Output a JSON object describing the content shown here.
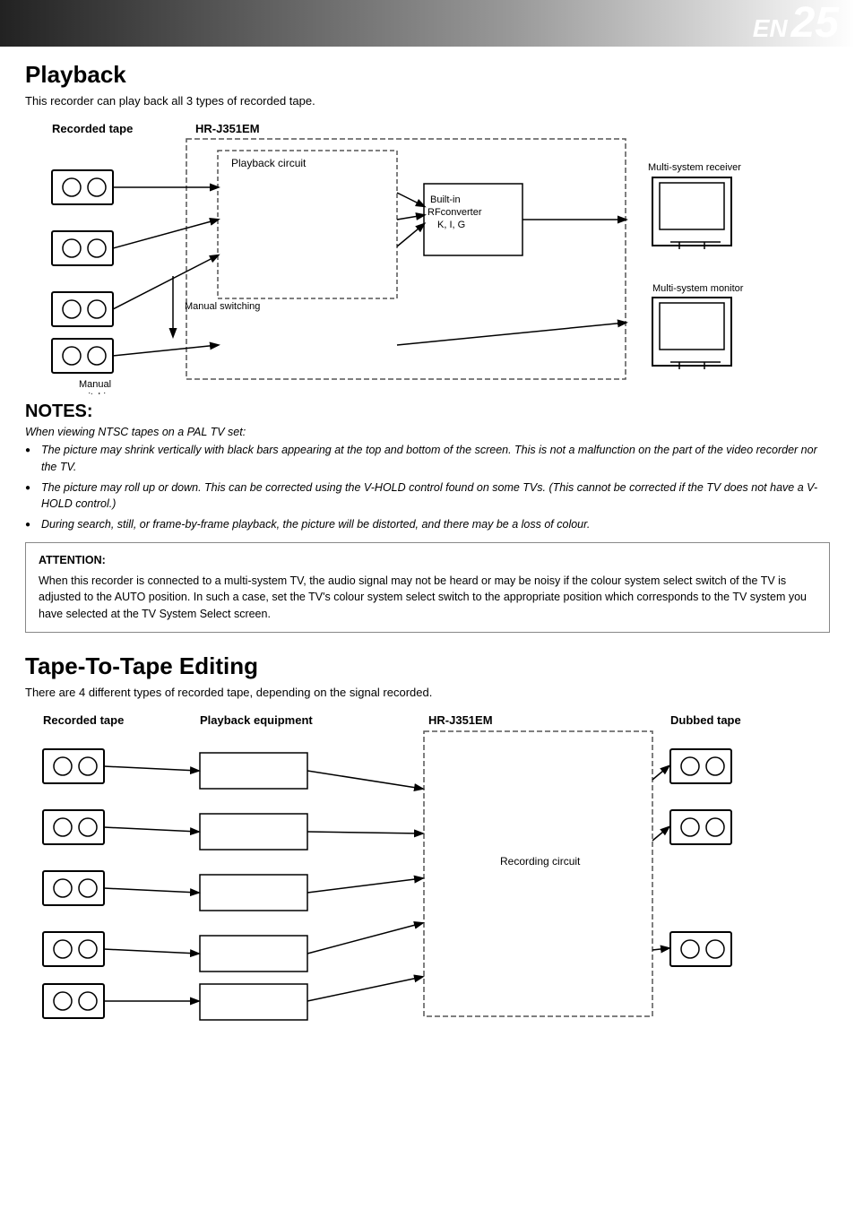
{
  "header": {
    "en_label": "EN",
    "page_number": "25"
  },
  "playback": {
    "title": "Playback",
    "subtitle": "This recorder can play back all 3 types of recorded tape.",
    "diagram": {
      "recorded_tape_label": "Recorded tape",
      "hr_label": "HR-J351EM",
      "playback_circuit_label": "Playback circuit",
      "built_in_label": "Built-in\nRFconverter\nK, I, G",
      "multi_system_receiver_label": "Multi-system receiver",
      "multi_system_monitor_label": "Multi-system monitor",
      "manual_switching_label1": "Manual\nswitching",
      "manual_switching_label2": "Manual switching"
    }
  },
  "notes": {
    "title": "NOTES:",
    "intro": "When viewing NTSC tapes on a PAL TV set:",
    "items": [
      "The picture may shrink vertically with black bars appearing at the top and bottom of the screen. This is not a malfunction on the part of the video recorder nor the TV.",
      "The picture may roll up or down. This can be corrected using the V-HOLD control found on some TVs. (This cannot be corrected if the TV does not have a V-HOLD control.)",
      "During search, still, or frame-by-frame playback, the picture will be distorted, and there may be a loss of colour."
    ],
    "attention": {
      "title": "ATTENTION:",
      "text": "When this recorder is connected to a multi-system TV, the audio signal may not be heard or may be noisy if the colour system select switch of the TV is adjusted to the AUTO position. In such a case, set the TV's colour system select switch to the appropriate position which corresponds to the TV system you have selected at the TV System Select screen."
    }
  },
  "tape_editing": {
    "title": "Tape-To-Tape Editing",
    "subtitle": "There are 4 different types of recorded tape, depending on the signal recorded.",
    "diagram": {
      "recorded_tape_label": "Recorded tape",
      "playback_equipment_label": "Playback equipment",
      "hr_label": "HR-J351EM",
      "dubbed_tape_label": "Dubbed tape",
      "recording_circuit_label": "Recording circuit"
    }
  }
}
